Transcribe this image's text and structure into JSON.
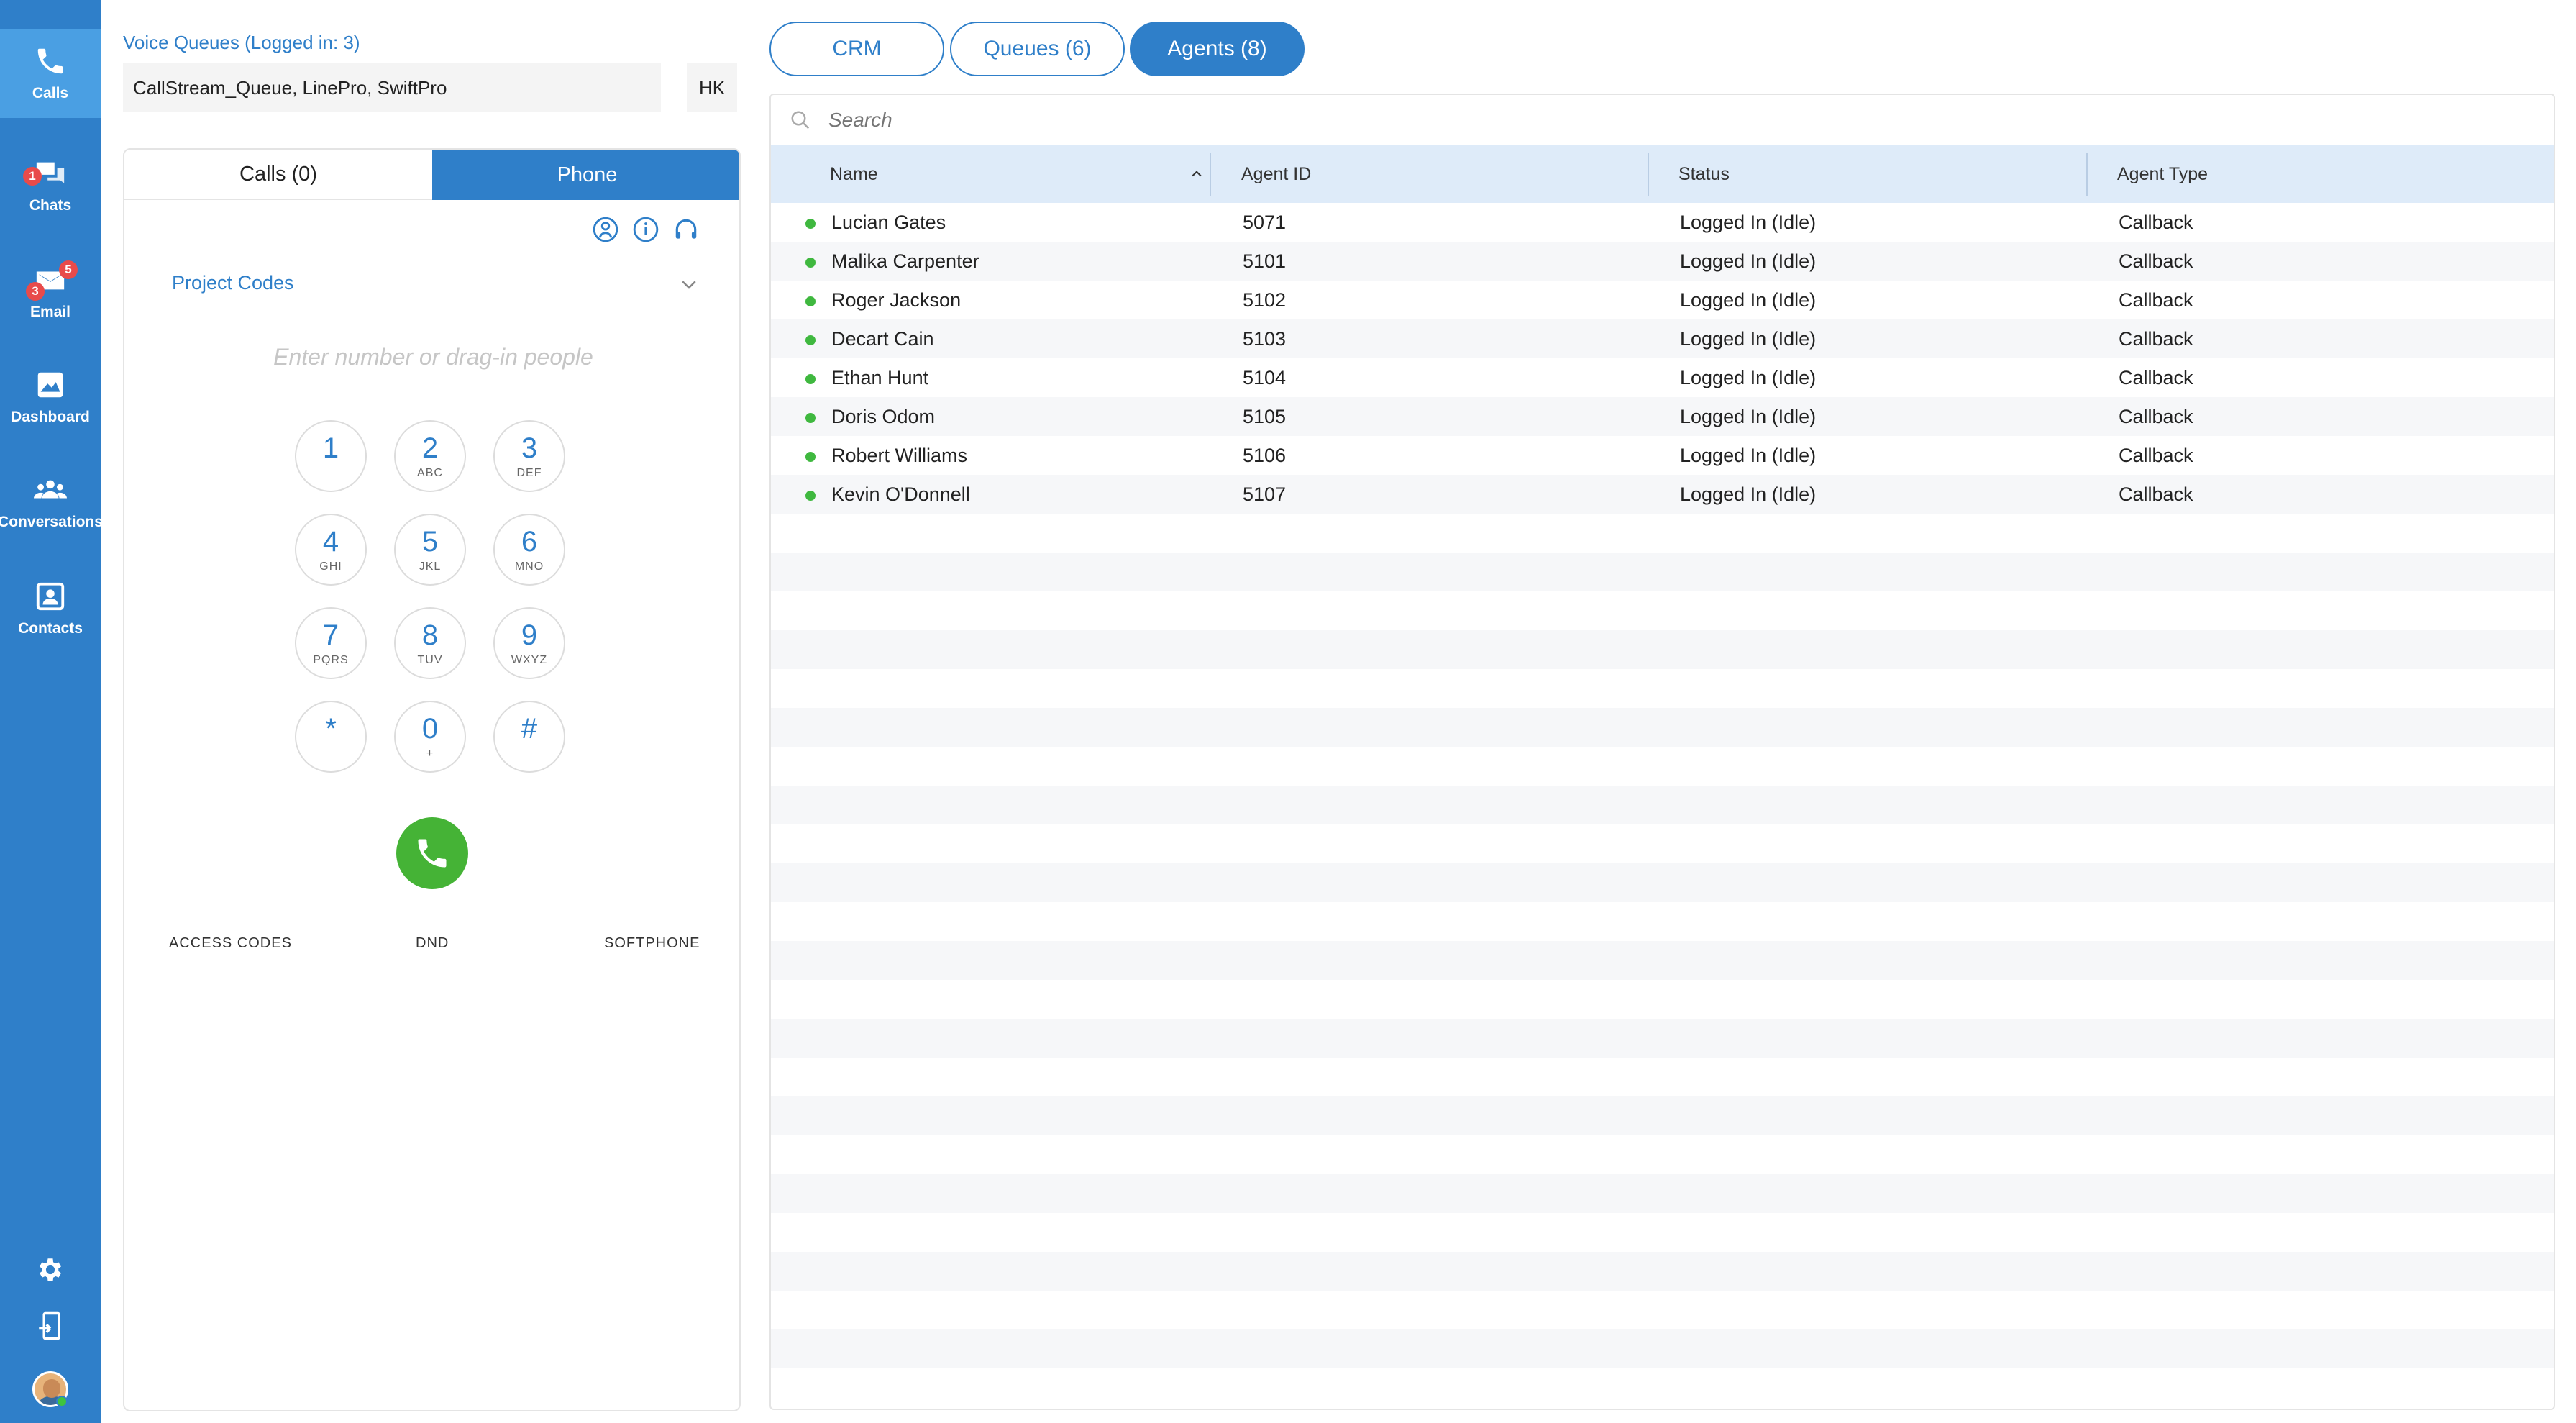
{
  "sidebar": {
    "items": [
      {
        "label": "Calls",
        "icon": "phone-icon"
      },
      {
        "label": "Chats",
        "icon": "chat-icon",
        "badge": "1"
      },
      {
        "label": "Email",
        "icon": "email-icon",
        "badge_top": "5",
        "badge_bottom": "3"
      },
      {
        "label": "Dashboard",
        "icon": "dashboard-icon"
      },
      {
        "label": "Conversations",
        "icon": "conversations-icon"
      },
      {
        "label": "Contacts",
        "icon": "contacts-icon"
      }
    ],
    "bottom": [
      "gear-icon",
      "logout-icon",
      "avatar"
    ]
  },
  "voice_queues": {
    "title": "Voice Queues (Logged in: 3)",
    "value": "CallStream_Queue, LinePro, SwiftPro",
    "region": "HK"
  },
  "phone_panel": {
    "tabs": [
      "Calls (0)",
      "Phone"
    ],
    "active_tab": "Phone",
    "project_codes": "Project Codes",
    "dial_placeholder": "Enter number or drag-in people",
    "keys": [
      {
        "digit": "1",
        "letters": ""
      },
      {
        "digit": "2",
        "letters": "ABC"
      },
      {
        "digit": "3",
        "letters": "DEF"
      },
      {
        "digit": "4",
        "letters": "GHI"
      },
      {
        "digit": "5",
        "letters": "JKL"
      },
      {
        "digit": "6",
        "letters": "MNO"
      },
      {
        "digit": "7",
        "letters": "PQRS"
      },
      {
        "digit": "8",
        "letters": "TUV"
      },
      {
        "digit": "9",
        "letters": "WXYZ"
      },
      {
        "digit": "*",
        "letters": ""
      },
      {
        "digit": "0",
        "letters": "+"
      },
      {
        "digit": "#",
        "letters": ""
      }
    ],
    "links": [
      "ACCESS CODES",
      "DND",
      "SOFTPHONE"
    ]
  },
  "top_tabs": [
    "CRM",
    "Queues (6)",
    "Agents (8)"
  ],
  "active_top_tab": "Agents (8)",
  "agents": {
    "search_placeholder": "Search",
    "columns": [
      "Name",
      "Agent ID",
      "Status",
      "Agent Type"
    ],
    "rows": [
      {
        "name": "Lucian Gates",
        "id": "5071",
        "status": "Logged In (Idle)",
        "type": "Callback"
      },
      {
        "name": "Malika Carpenter",
        "id": "5101",
        "status": "Logged In (Idle)",
        "type": "Callback"
      },
      {
        "name": "Roger Jackson",
        "id": "5102",
        "status": "Logged In (Idle)",
        "type": "Callback"
      },
      {
        "name": "Decart Cain",
        "id": "5103",
        "status": "Logged In (Idle)",
        "type": "Callback"
      },
      {
        "name": "Ethan Hunt",
        "id": "5104",
        "status": "Logged In (Idle)",
        "type": "Callback"
      },
      {
        "name": "Doris Odom",
        "id": "5105",
        "status": "Logged In (Idle)",
        "type": "Callback"
      },
      {
        "name": "Robert Williams",
        "id": "5106",
        "status": "Logged In (Idle)",
        "type": "Callback"
      },
      {
        "name": "Kevin O'Donnell",
        "id": "5107",
        "status": "Logged In (Idle)",
        "type": "Callback"
      }
    ]
  },
  "colors": {
    "brand": "#2f7fc9",
    "active_nav": "#4a9fe3",
    "call_green": "#45b336",
    "status_green": "#3fb83f",
    "badge_red": "#e84b4b"
  }
}
